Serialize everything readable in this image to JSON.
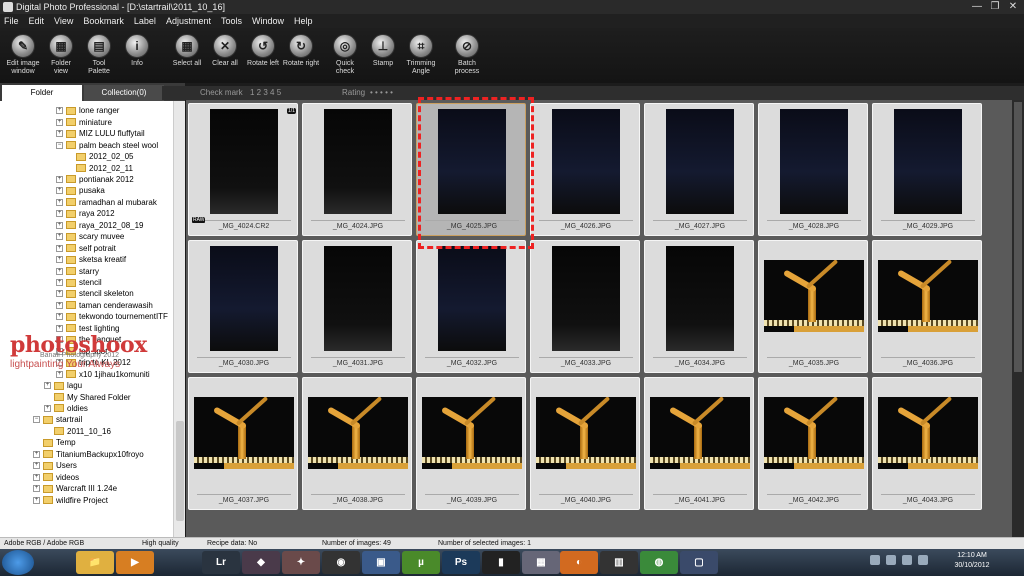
{
  "window": {
    "title": "Digital Photo Professional - [D:\\startrail\\2011_10_16]",
    "controls": [
      "—",
      "❐",
      "✕"
    ]
  },
  "menu": [
    "File",
    "Edit",
    "View",
    "Bookmark",
    "Label",
    "Adjustment",
    "Tools",
    "Window",
    "Help"
  ],
  "toolbar": [
    {
      "label": "Edit image\nwindow",
      "icon": "edit-image-window-icon",
      "glyph": "✎"
    },
    {
      "label": "Folder\nview",
      "icon": "folder-view-icon",
      "glyph": "▦"
    },
    {
      "label": "Tool\nPalette",
      "icon": "tool-palette-icon",
      "glyph": "▤"
    },
    {
      "label": "Info",
      "icon": "info-icon",
      "glyph": "i"
    },
    {
      "label": "Select all",
      "icon": "select-all-icon",
      "glyph": "▦"
    },
    {
      "label": "Clear all",
      "icon": "clear-all-icon",
      "glyph": "✕"
    },
    {
      "label": "Rotate left",
      "icon": "rotate-left-icon",
      "glyph": "↺"
    },
    {
      "label": "Rotate right",
      "icon": "rotate-right-icon",
      "glyph": "↻"
    },
    {
      "label": "Quick\ncheck",
      "icon": "quick-check-icon",
      "glyph": "◎"
    },
    {
      "label": "Stamp",
      "icon": "stamp-icon",
      "glyph": "⊥"
    },
    {
      "label": "Trimming\nAngle",
      "icon": "trimming-angle-icon",
      "glyph": "⌗"
    },
    {
      "label": "Batch\nprocess",
      "icon": "batch-process-icon",
      "glyph": "⊘"
    }
  ],
  "tabs": {
    "folder": "Folder",
    "collection": "Collection(0)"
  },
  "header": {
    "checkmark": "Check mark",
    "checkmark_nums": "1 2 3 4 5",
    "rating": "Rating",
    "rating_dots": "• • • • •"
  },
  "tree": [
    {
      "label": "lone ranger",
      "expander": "+",
      "level": 0
    },
    {
      "label": "miniature",
      "expander": "+",
      "level": 0
    },
    {
      "label": "MIZ LULU fluffytail",
      "expander": "+",
      "level": 0
    },
    {
      "label": "palm beach steel wool",
      "expander": "−",
      "level": 0
    },
    {
      "label": "2012_02_05",
      "expander": "",
      "level": 1
    },
    {
      "label": "2012_02_11",
      "expander": "",
      "level": 1
    },
    {
      "label": "pontianak 2012",
      "expander": "+",
      "level": 0
    },
    {
      "label": "pusaka",
      "expander": "+",
      "level": 0
    },
    {
      "label": "ramadhan al mubarak",
      "expander": "+",
      "level": 0
    },
    {
      "label": "raya 2012",
      "expander": "+",
      "level": 0
    },
    {
      "label": "raya_2012_08_19",
      "expander": "+",
      "level": 0
    },
    {
      "label": "scary muvee",
      "expander": "+",
      "level": 0
    },
    {
      "label": "self potrait",
      "expander": "+",
      "level": 0
    },
    {
      "label": "sketsa kreatif",
      "expander": "+",
      "level": 0
    },
    {
      "label": "starry",
      "expander": "+",
      "level": 0
    },
    {
      "label": "stencil",
      "expander": "+",
      "level": 0
    },
    {
      "label": "stencil skeleton",
      "expander": "+",
      "level": 0
    },
    {
      "label": "taman cenderawasih",
      "expander": "+",
      "level": 0
    },
    {
      "label": "tekwondo tournementITF",
      "expander": "+",
      "level": 0
    },
    {
      "label": "test lighting",
      "expander": "+",
      "level": 0
    },
    {
      "label": "the banquet",
      "expander": "+",
      "level": 0
    },
    {
      "label": "top spot",
      "expander": "+",
      "level": 0
    },
    {
      "label": "trip to KL 2012",
      "expander": "+",
      "level": 0
    },
    {
      "label": "x10 1jihau1komuniti",
      "expander": "+",
      "level": 0
    },
    {
      "label": "lagu",
      "expander": "+",
      "level": -1
    },
    {
      "label": "My Shared Folder",
      "expander": "",
      "level": -1
    },
    {
      "label": "oldies",
      "expander": "+",
      "level": -1
    },
    {
      "label": "startrail",
      "expander": "−",
      "level": -2
    },
    {
      "label": "2011_10_16",
      "expander": "",
      "level": -1
    },
    {
      "label": "Temp",
      "expander": "",
      "level": -3
    },
    {
      "label": "TitaniumBackupx10froyo",
      "expander": "+",
      "level": -3
    },
    {
      "label": "Users",
      "expander": "+",
      "level": -3
    },
    {
      "label": "videos",
      "expander": "+",
      "level": -3
    },
    {
      "label": "Warcraft III 1.24e",
      "expander": "+",
      "level": -3
    },
    {
      "label": "wildfire Project",
      "expander": "+",
      "level": -3
    }
  ],
  "watermark": {
    "brand": "photoshoox",
    "line2": "Banafi Photography 2012",
    "line3": "lightpainting Your Always"
  },
  "thumbnails": [
    {
      "name": "_MG_4024.CR2",
      "kind": "dark",
      "raw": true
    },
    {
      "name": "_MG_4024.JPG",
      "kind": "dark"
    },
    {
      "name": "_MG_4025.JPG",
      "kind": "blue",
      "selected": true
    },
    {
      "name": "_MG_4026.JPG",
      "kind": "blue"
    },
    {
      "name": "_MG_4027.JPG",
      "kind": "blue"
    },
    {
      "name": "_MG_4028.JPG",
      "kind": "blue"
    },
    {
      "name": "_MG_4029.JPG",
      "kind": "blue"
    },
    {
      "name": "_MG_4030.JPG",
      "kind": "blue"
    },
    {
      "name": "_MG_4031.JPG",
      "kind": "dark"
    },
    {
      "name": "_MG_4032.JPG",
      "kind": "blue"
    },
    {
      "name": "_MG_4033.JPG",
      "kind": "dark"
    },
    {
      "name": "_MG_4034.JPG",
      "kind": "dark"
    },
    {
      "name": "_MG_4035.JPG",
      "kind": "sculpture"
    },
    {
      "name": "_MG_4036.JPG",
      "kind": "sculpture"
    },
    {
      "name": "_MG_4037.JPG",
      "kind": "sculpture"
    },
    {
      "name": "_MG_4038.JPG",
      "kind": "sculpture"
    },
    {
      "name": "_MG_4039.JPG",
      "kind": "sculpture"
    },
    {
      "name": "_MG_4040.JPG",
      "kind": "sculpture"
    },
    {
      "name": "_MG_4041.JPG",
      "kind": "sculpture"
    },
    {
      "name": "_MG_4042.JPG",
      "kind": "sculpture"
    },
    {
      "name": "_MG_4043.JPG",
      "kind": "sculpture"
    }
  ],
  "raw_badge": "RAW",
  "jpg_badge": "1/1",
  "status": {
    "color": "Adobe RGB / Adobe RGB",
    "quality": "High quality",
    "recipe": "Recipe data: No",
    "count": "Number of images: 49",
    "selected": "Number of selected images: 1"
  },
  "taskbar": {
    "apps": [
      {
        "name": "explorer-app",
        "glyph": "📁",
        "bg": "#e0b040"
      },
      {
        "name": "media-app",
        "glyph": "▶",
        "bg": "#d77e22"
      },
      {
        "name": "lightroom-app",
        "glyph": "Lr",
        "bg": "#2a3440"
      },
      {
        "name": "game-app",
        "glyph": "◆",
        "bg": "#4a3a4a"
      },
      {
        "name": "shooter-app",
        "glyph": "✦",
        "bg": "#6a4a4a"
      },
      {
        "name": "sync-app",
        "glyph": "◉",
        "bg": "#333"
      },
      {
        "name": "installer-app",
        "glyph": "▣",
        "bg": "#3a5a8a"
      },
      {
        "name": "utorrent-app",
        "glyph": "µ",
        "bg": "#4a8a2a"
      },
      {
        "name": "photoshop-app",
        "glyph": "Ps",
        "bg": "#1c3a5a"
      },
      {
        "name": "cmd-app",
        "glyph": "▮",
        "bg": "#222"
      },
      {
        "name": "dpp-app",
        "glyph": "▦",
        "bg": "#667"
      },
      {
        "name": "app-extra",
        "glyph": "▥",
        "bg": "#333"
      },
      {
        "name": "firefox-app",
        "glyph": "◐",
        "bg": "#d26a20"
      },
      {
        "name": "chrome-app",
        "glyph": "◍",
        "bg": "#3a8a3a"
      },
      {
        "name": "display-app",
        "glyph": "▢",
        "bg": "#3a4a6a"
      }
    ],
    "time": "12:10 AM",
    "date": "30/10/2012"
  }
}
